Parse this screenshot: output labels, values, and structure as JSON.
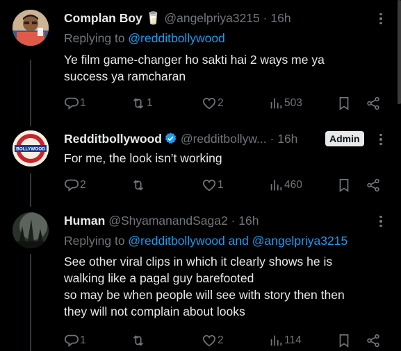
{
  "tweets": [
    {
      "name": "Complan Boy",
      "name_emoji": "🥛",
      "handle": "@angelpriya3215",
      "time": "· 16h",
      "replying_prefix": "Replying to ",
      "replying_to": "@redditbollywood",
      "text_lines": [
        "Ye film game-changer ho sakti hai 2 ways me ya",
        "success ya ramcharan"
      ],
      "actions": {
        "replies": "1",
        "reposts": "1",
        "likes": "2",
        "views": "503"
      }
    },
    {
      "name": "Redditbollywood",
      "handle": "@redditbollyw...",
      "time": "· 16h",
      "badge": "Admin",
      "avatar_text": "BOLLYWOOD",
      "text_lines": [
        "For me, the look isn’t working"
      ],
      "actions": {
        "replies": "2",
        "reposts": "",
        "likes": "1",
        "views": "460"
      }
    },
    {
      "name": "Human",
      "handle": "@ShyamanandSaga2",
      "time": "· 16h",
      "replying_prefix": "Replying to ",
      "replying_to": "@redditbollywood",
      "replying_and": " and ",
      "replying_to_2": "@angelpriya3215",
      "text_lines": [
        "See other viral clips in which it clearly shows he is",
        "walking like a pagal guy barefooted",
        "so may be when people will see with story then then",
        "they will not complain about looks"
      ],
      "actions": {
        "replies": "1",
        "reposts": "",
        "likes": "2",
        "views": "114"
      }
    }
  ],
  "colors": {
    "background": "#000000",
    "text": "#e7e9ea",
    "muted": "#71767b",
    "link": "#1d9bf0",
    "verified": "#1d9bf0"
  }
}
